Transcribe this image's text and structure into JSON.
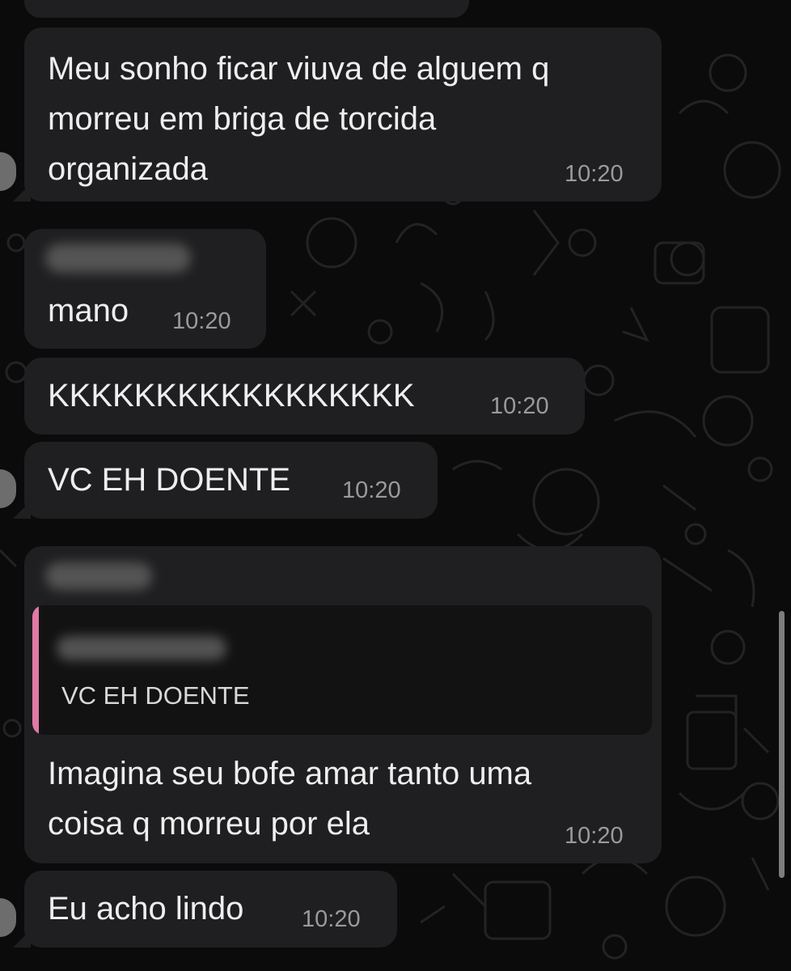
{
  "colors": {
    "background": "#0b0b0b",
    "bubble": "#1f1f21",
    "text": "#eeeeee",
    "time": "#9a9a9a",
    "quote_bar": "#e07aa6",
    "quote_bg": "#121212"
  },
  "messages": [
    {
      "lines": [
        "Meu sonho ficar viuva de alguem q",
        "morreu em briga de torcida",
        "organizada"
      ],
      "time": "10:20"
    },
    {
      "sender_hidden": true,
      "text": "mano",
      "time": "10:20"
    },
    {
      "text": "KKKKKKKKKKKKKKKKK",
      "time": "10:20"
    },
    {
      "text": "VC EH DOENTE",
      "time": "10:20"
    },
    {
      "sender_hidden": true,
      "quote": {
        "sender_hidden": true,
        "text": "VC EH DOENTE"
      },
      "lines": [
        "Imagina seu bofe amar tanto uma",
        "coisa q morreu por ela"
      ],
      "time": "10:20"
    },
    {
      "text": "Eu acho lindo",
      "time": "10:20"
    }
  ]
}
